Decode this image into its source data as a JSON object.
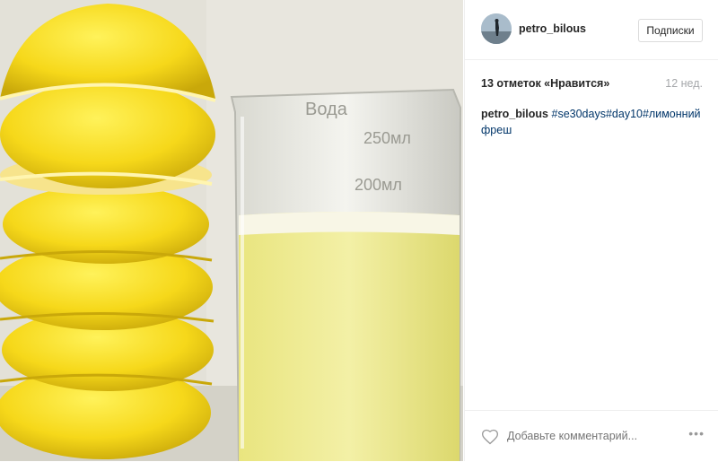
{
  "post": {
    "username": "petro_bilous",
    "follow_label": "Подписки",
    "likes": "13 отметок «Нравится»",
    "time": "12 нед.",
    "caption": {
      "username": "petro_bilous",
      "tag1": "#se30days",
      "tag2": "#day10",
      "tag3": "#лимонний",
      "tag3_cont": "фреш"
    },
    "comment_placeholder": "Добавьте комментарий...",
    "more_label": "•••"
  },
  "photo": {
    "beaker_text": [
      "Вода",
      "250мл",
      "200мл"
    ]
  }
}
